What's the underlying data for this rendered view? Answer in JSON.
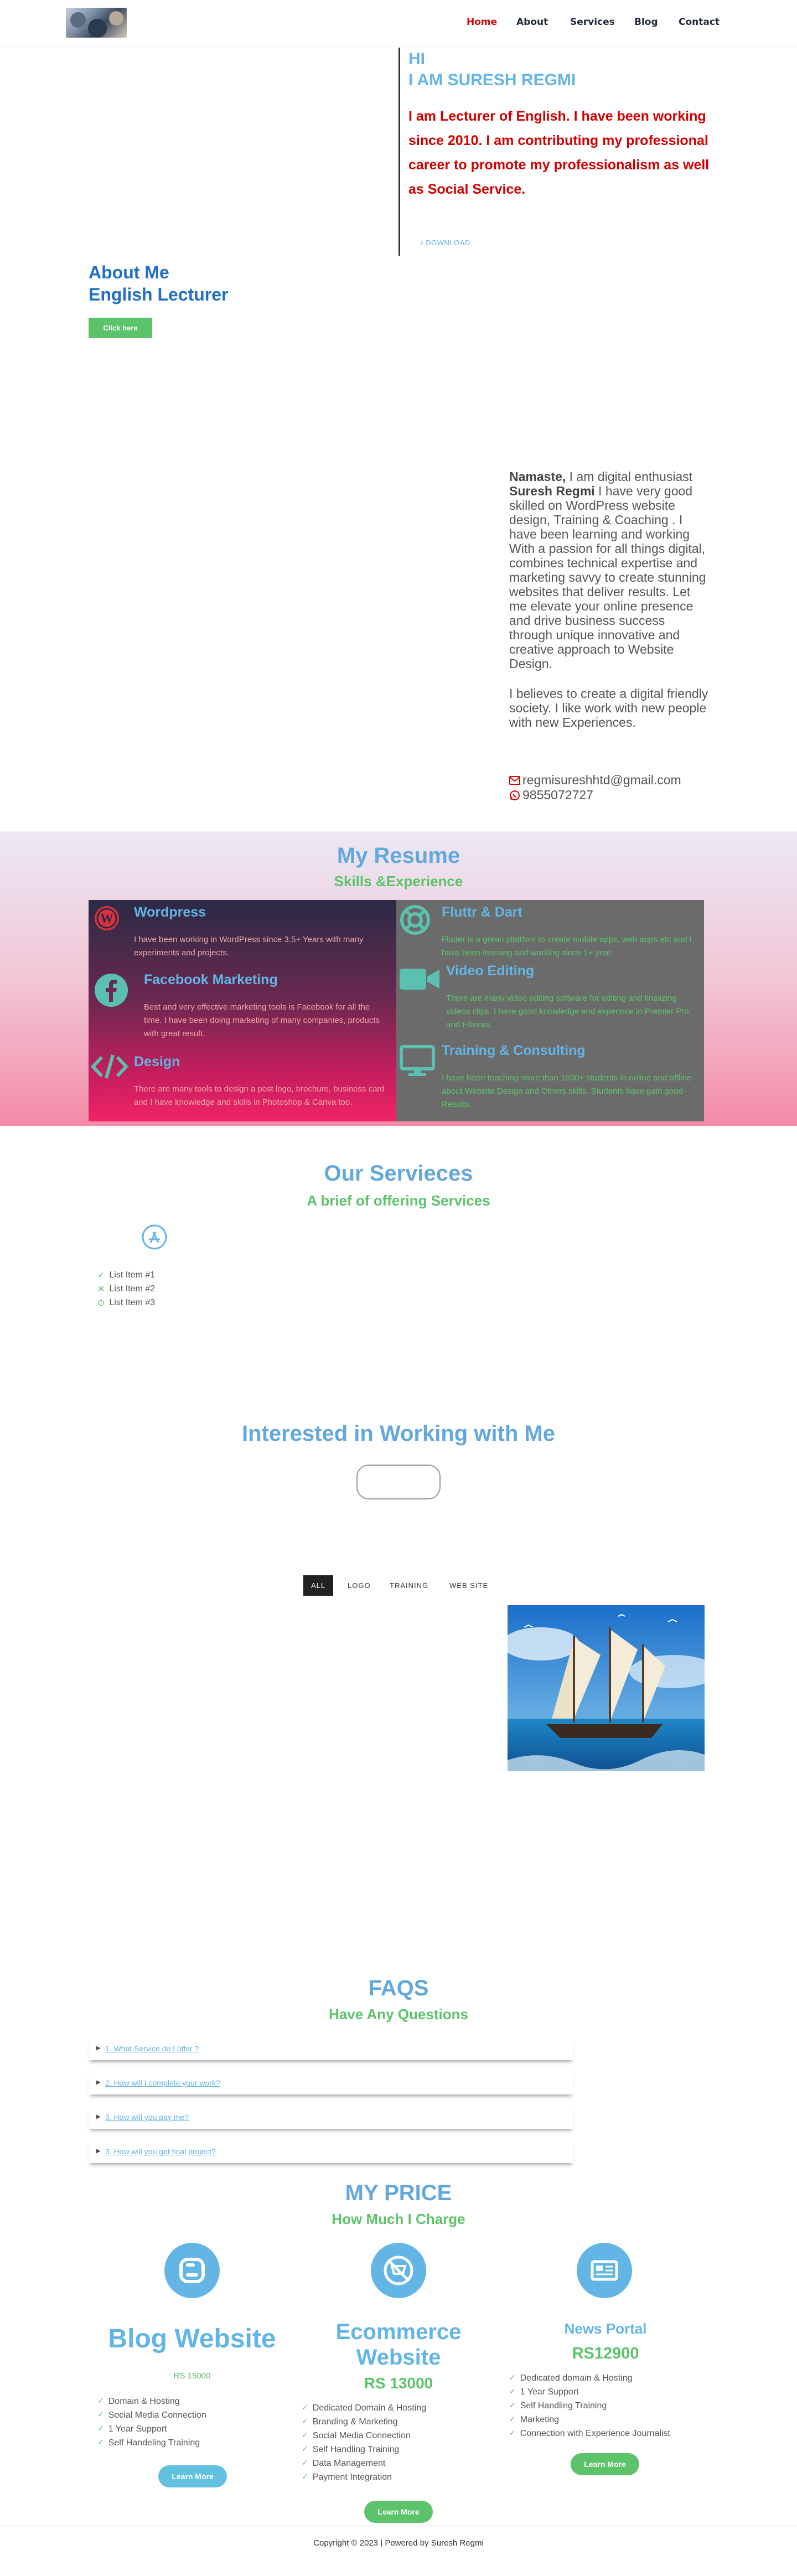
{
  "nav": {
    "items": [
      {
        "label": "Home",
        "active": true
      },
      {
        "label": "About",
        "active": false
      },
      {
        "label": "Services",
        "active": false
      },
      {
        "label": "Blog",
        "active": false
      },
      {
        "label": "Contact",
        "active": false
      }
    ]
  },
  "hero": {
    "hi": "HI",
    "name": "I AM SURESH REGMI",
    "bio": "I am Lecturer of English. I have been working since 2010. I am contributing my professional career to promote my professionalism as well as Social Service.",
    "download_label": "DOWNLOAD",
    "about_title": "About Me",
    "about_role": "English Lecturer",
    "click_label": "Click here"
  },
  "intro": {
    "greeting": "Namaste,",
    "text_1": " I am digital enthusiast ",
    "name": "Suresh Regmi",
    "text_2": " I have very good skilled on WordPress website design, Training & Coaching . I have been learning and working With a passion for all things digital, combines technical expertise and marketing savvy to create stunning websites that deliver results. Let me elevate your online presence and drive business success through unique innovative and creative approach to Website Design.",
    "para_2": "I believes to create a digital friendly society. I like work with new people with new Experiences.",
    "email": "regmisureshhtd@gmail.com",
    "phone": "9855072727"
  },
  "resume": {
    "title": "My Resume",
    "subtitle": "Skills &Experience",
    "left": [
      {
        "title": "Wordpress",
        "text": "I have been working in WordPress since 3.5+ Years with many experiments and projects."
      },
      {
        "title": "Facebook Marketing",
        "text": "Best and very effective marketing tools is Facebook for all the time. I have been doing marketing of many companies, products with great result."
      },
      {
        "title": "Design",
        "text": "There are many tools to design a post logo, brochure, business card and I have knowledge and skills in Photoshop & Canva too."
      }
    ],
    "right": [
      {
        "title": "Fluttr & Dart",
        "text": "Flutter is a grean plattfom to create mobile apps, web apps etc and I have been learning and working since 1+ year."
      },
      {
        "title": "Video Editing",
        "text": "There are many video editing software for editing and finalizing videos clips. I have good knowledge and experince in Premier Pro and Filmora."
      },
      {
        "title": "Training & Consulting",
        "text": "I have been teaching more than 1000+ students in online and offline about Website Design and Others skills. Students have gain good Results."
      }
    ]
  },
  "services": {
    "title": "Our Servieces",
    "subtitle": "A brief of offering Services",
    "items": [
      "List Item #1",
      "List Item #2",
      "List Item #3"
    ]
  },
  "interest": {
    "title": "Interested in Working with Me"
  },
  "portfolio": {
    "filters": [
      {
        "label": "ALL",
        "active": true
      },
      {
        "label": "LOGO",
        "active": false
      },
      {
        "label": "TRAINING",
        "active": false
      },
      {
        "label": "WEB SITE",
        "active": false
      }
    ]
  },
  "faq": {
    "title": "FAQS",
    "subtitle": "Have Any Questions",
    "items": [
      "1. What Service do I offer ?",
      "2. How will I complete your work?",
      "3. How will you pay me?",
      "3. How will you get final project?"
    ]
  },
  "pricing": {
    "title": "MY PRICE",
    "subtitle": "How Much I Charge",
    "plans": [
      {
        "name": "Blog Website",
        "price": "RS 15000",
        "features": [
          "Domain & Hosting",
          "Social Media Connection",
          "1 Year Support",
          "Self Handeling Training"
        ],
        "button": "Learn More",
        "icon": "blogger-icon"
      },
      {
        "name": "Ecommerce Website",
        "price": "RS 13000",
        "features": [
          "Dedicated Domain & Hosting",
          "Branding & Marketing",
          "Social Media Connection",
          "Self Handling Training",
          "Data Management",
          "Payment Integration"
        ],
        "button": "Learn More",
        "icon": "no-cart-icon"
      },
      {
        "name": "News Portal",
        "price": "RS12900",
        "features": [
          "Dedicated domain & Hosting",
          "1 Year Support",
          "Self Handling Training",
          "Marketing",
          "Connection with Experience Journalist"
        ],
        "button": "Learn More",
        "icon": "newspaper-icon"
      }
    ]
  },
  "footer": {
    "text": "Copyright © 2023 | Powered by Suresh Regmi"
  },
  "colors": {
    "accent_blue": "#62b5e5",
    "accent_green": "#5cc36b",
    "nav_active": "#d60000",
    "hero_bio": "#d40000"
  }
}
